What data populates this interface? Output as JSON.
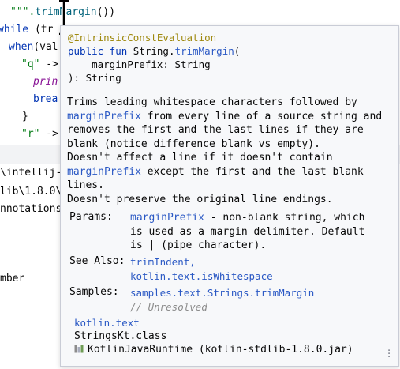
{
  "editor": {
    "lines": [
      {
        "indent": "",
        "parts": [
          {
            "t": "\"\"\".",
            "c": "str"
          },
          {
            "t": "trimMargin",
            "c": "fn"
          },
          {
            "t": "())",
            "c": ""
          }
        ]
      },
      {
        "indent": "",
        "parts": [
          {
            "t": "while",
            "c": "kw"
          },
          {
            "t": " (tr",
            "c": ""
          }
        ]
      },
      {
        "indent": "",
        "parts": [
          {
            "t": "when",
            "c": "kw"
          },
          {
            "t": "(val",
            "c": ""
          }
        ]
      },
      {
        "indent": "",
        "parts": [
          {
            "t": "\"q\"",
            "c": "str"
          },
          {
            "t": " ->",
            "c": ""
          }
        ]
      },
      {
        "indent": "",
        "parts": [
          {
            "t": "prin",
            "c": "purple"
          }
        ]
      },
      {
        "indent": "",
        "parts": [
          {
            "t": "brea",
            "c": "kw"
          }
        ]
      },
      {
        "indent": "",
        "parts": [
          {
            "t": "}",
            "c": ""
          }
        ]
      },
      {
        "indent": "",
        "parts": [
          {
            "t": "\"r\"",
            "c": "str"
          },
          {
            "t": " ->",
            "c": ""
          }
        ]
      }
    ]
  },
  "console": {
    "lines": [
      "\\intellij-",
      "lib\\1.8.0\\",
      "nnotations",
      "",
      "",
      "mber"
    ]
  },
  "popup": {
    "definition": {
      "annotation": "@IntrinsicConstEvaluation",
      "line2_kw": "public fun ",
      "line2_type": "String.",
      "line2_fn": "trimMargin",
      "line2_paren": "(",
      "line3": "    marginPrefix: String",
      "line4": "): String"
    },
    "description": {
      "p1_a": "Trims leading whitespace characters followed by ",
      "p1_ref": "marginPrefix",
      "p1_b": " from every line of a source string and removes the first and the last lines if they are blank (notice difference blank vs empty).",
      "p2_a": "Doesn't affect a line if it doesn't contain ",
      "p2_ref": "marginPrefix",
      "p2_b": " except the first and the last blank lines.",
      "p3": "Doesn't preserve the original line endings."
    },
    "params": {
      "label": "Params:",
      "name": "marginPrefix",
      "desc_line1": " - non-blank string, which",
      "desc_line2": "is used as a margin delimiter. Default",
      "desc_line3": "is | (pipe character)."
    },
    "see_also": {
      "label": "See Also:",
      "link1": "trimIndent,",
      "link2": "kotlin.text.isWhitespace"
    },
    "samples": {
      "label": "Samples:",
      "link": "samples.text.Strings.trimMargin",
      "comment": "// Unresolved"
    },
    "footer": {
      "package": "kotlin.text",
      "class": "StringsKt.class",
      "library": "KotlinJavaRuntime (kotlin-stdlib-1.8.0.jar)"
    }
  }
}
